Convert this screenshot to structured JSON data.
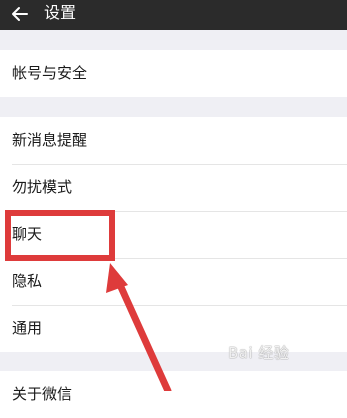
{
  "header": {
    "title": "设置",
    "back_icon": "back-arrow-icon"
  },
  "groups": [
    {
      "items": [
        "帐号与安全"
      ]
    },
    {
      "items": [
        "新消息提醒",
        "勿扰模式",
        "聊天",
        "隐私",
        "通用"
      ]
    },
    {
      "items": [
        "关于微信"
      ]
    }
  ],
  "highlight": {
    "target": "聊天",
    "color": "#de3b3b"
  },
  "watermark": "Bai 经验"
}
